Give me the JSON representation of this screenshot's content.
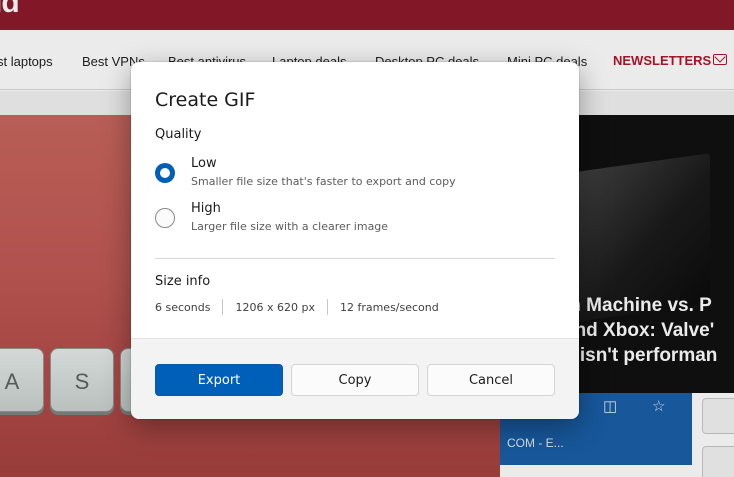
{
  "background": {
    "logo_fragment": "ld",
    "nav": {
      "items": [
        "st laptops",
        "Best VPNs",
        "Best antivirus",
        "Laptop deals",
        "Desktop PC deals",
        "Mini PC deals"
      ],
      "newsletters": "NEWSLETTERS"
    },
    "hero_keys": [
      "A",
      "S"
    ],
    "card_headline": [
      "m Machine vs. P",
      "and Xbox: Valve'",
      "e isn't performan"
    ],
    "lower_text": "COM - E..."
  },
  "dialog": {
    "title": "Create GIF",
    "quality_label": "Quality",
    "options": [
      {
        "label": "Low",
        "description": "Smaller file size that's faster to export and copy",
        "selected": true
      },
      {
        "label": "High",
        "description": "Larger file size with a clearer image",
        "selected": false
      }
    ],
    "size_info_label": "Size info",
    "size_info": {
      "duration": "6 seconds",
      "dimensions": "1206 x 620 px",
      "frame_rate": "12 frames/second"
    },
    "buttons": {
      "export": "Export",
      "copy": "Copy",
      "cancel": "Cancel"
    }
  },
  "colors": {
    "accent": "#005fb8",
    "site_brand": "#8e1b2b",
    "newsletters": "#b0162c"
  }
}
